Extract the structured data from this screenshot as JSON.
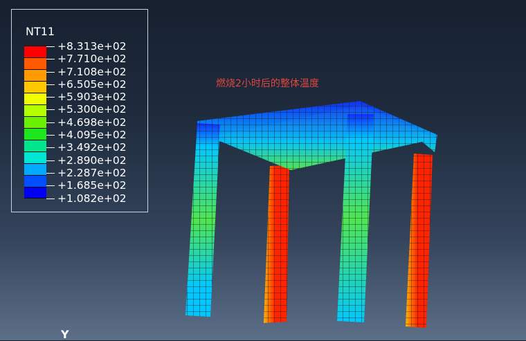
{
  "legend": {
    "title": "NT11",
    "colors": [
      "#ff0000",
      "#ff5a00",
      "#ff9a00",
      "#ffc800",
      "#f0ff00",
      "#b4ff00",
      "#6af000",
      "#1ee61e",
      "#00e68c",
      "#00e6d2",
      "#00aaff",
      "#0050ff",
      "#0000f0"
    ],
    "values": [
      "+8.313e+02",
      "+7.710e+02",
      "+7.108e+02",
      "+6.505e+02",
      "+5.903e+02",
      "+5.300e+02",
      "+4.698e+02",
      "+4.095e+02",
      "+3.492e+02",
      "+2.890e+02",
      "+2.287e+02",
      "+1.685e+02",
      "+1.082e+02"
    ]
  },
  "annotation": "燃烧2小时后的整体温度",
  "axis_triad": {
    "label": "Y"
  },
  "model": {
    "contour_colors": {
      "hot": "#ff2400",
      "warm": "#ffb400",
      "mid": "#50e650",
      "cool": "#00c8ff",
      "cold": "#1030ff",
      "slab_top": "#a8b028",
      "mesh_line": "#1a1a1a"
    }
  }
}
